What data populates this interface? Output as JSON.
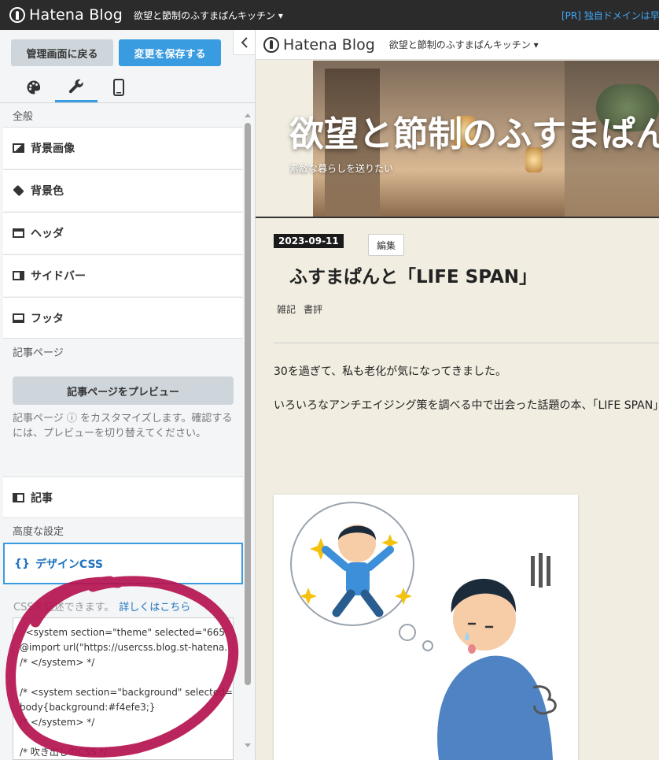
{
  "topbar": {
    "logo": "Hatena Blog",
    "blog_name": "欲望と節制のふすまぱんキッチン",
    "pr_text": "[PR] 独自ドメインは早"
  },
  "panel": {
    "back_button": "管理画面に戻る",
    "save_button": "変更を保存する",
    "tabs": [
      {
        "name": "palette-icon",
        "active": false
      },
      {
        "name": "wrench-icon",
        "active": true
      },
      {
        "name": "smartphone-icon",
        "active": false
      }
    ],
    "sections": {
      "general": "全般",
      "article_page": "記事ページ",
      "advanced": "高度な設定"
    },
    "general_items": [
      "背景画像",
      "背景色",
      "ヘッダ",
      "サイドバー",
      "フッタ"
    ],
    "preview_button": "記事ページをプレビュー",
    "article_desc": "記事ページ ⓘ をカスタマイズします。確認するには、プレビューを切り替えてください。",
    "article_item": "記事",
    "design_css": {
      "icon": "{}",
      "label": "デザインCSS"
    },
    "css_note": "CSSを記述できます。",
    "css_link": "詳しくはこちら",
    "css_code": "  <system section=\"theme\" selected=\"665\n@import url(\"https://usercss.blog.st-hatena.\n/* </system> */\n\n/* <system section=\"background\" selected=\nbody{background:#f4efe3;}\n/* </system> */\n\n/* 吹き出しのCSS */"
  },
  "preview": {
    "bar_logo": "Hatena Blog",
    "bar_blog_name": "欲望と節制のふすまぱんキッチン",
    "hero_title": "欲望と節制のふすまぱんキッチン",
    "hero_subtitle": "素敵な暮らしを送りたい",
    "date": "2023-09-11",
    "edit_button": "編集",
    "post_title": "ふすまぱんと「LIFE SPAN」",
    "categories": [
      "雑記",
      "書評"
    ],
    "paragraphs": [
      "30を過ぎて、私も老化が気になってきました。",
      "いろいろなアンチエイジング策を調べる中で出会った話題の本、「LIFE SPAN」"
    ]
  },
  "colors": {
    "accent": "#3a9ce0",
    "annotation": "#b5124f",
    "page_bg": "#f1ede1"
  }
}
